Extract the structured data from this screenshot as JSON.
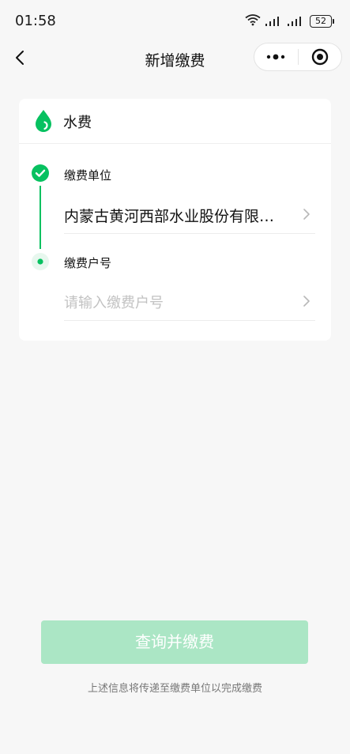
{
  "status_bar": {
    "time": "01:58",
    "battery": "52"
  },
  "nav": {
    "title": "新增缴费"
  },
  "card": {
    "title": "水费",
    "step1": {
      "label": "缴费单位",
      "value": "内蒙古黄河西部水业股份有限公司"
    },
    "step2": {
      "label": "缴费户号",
      "placeholder": "请输入缴费户号"
    }
  },
  "submit": {
    "label": "查询并缴费"
  },
  "footer": {
    "note": "上述信息将传递至缴费单位以完成缴费"
  },
  "colors": {
    "accent": "#07c160",
    "button_disabled": "#abe6c5",
    "background": "#f7f7f7"
  }
}
